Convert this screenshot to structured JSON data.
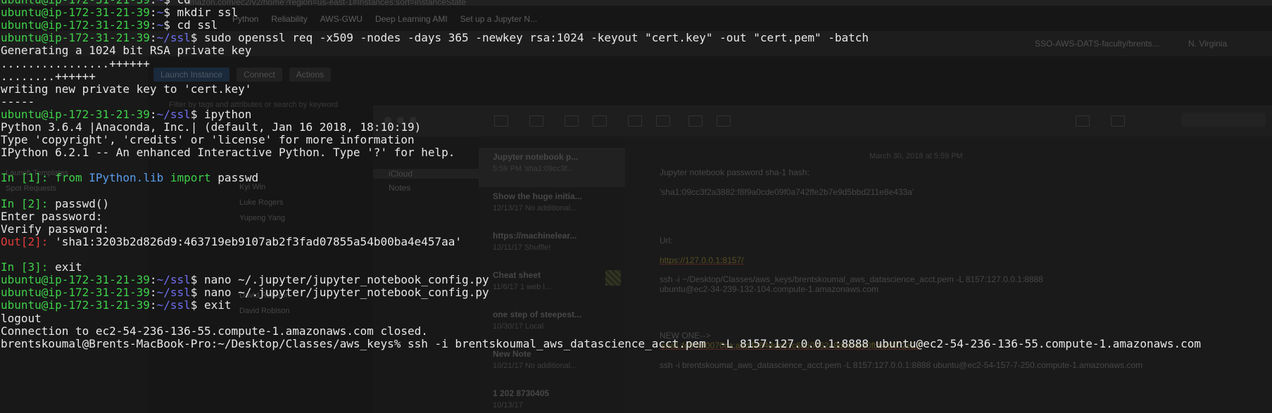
{
  "background": {
    "browser_url": "amazon.com/ec2/v2/home?region=us-east-1#Instances:sort=instanceState",
    "bookmarks": [
      "Python",
      "Reliability",
      "AWS-GWU",
      "Deep Learning AMI",
      "Set up a Jupyter N..."
    ],
    "aws_account": "SSO-AWS-DATS-faculty/brents...",
    "aws_region": "N. Virginia",
    "ec2_buttons": [
      "Launch Instance",
      "Connect",
      "Actions"
    ],
    "ec2_search_placeholder": "Filter by tags and attributes or search by keyword",
    "left_nav_items": [
      "Launch Templates",
      "Spot Requests"
    ],
    "names_column": [
      "Kyi Win",
      "Luke Rogers",
      "Yupeng Yang",
      "David Robison",
      "David Robison"
    ],
    "notes": {
      "folders": [
        "iCloud",
        "Notes"
      ],
      "list": [
        {
          "title": "Jupyter notebook p...",
          "meta": "5:59 PM  'sha1:09cc3f..."
        },
        {
          "title": "Show the huge initia...",
          "meta": "12/13/17  No additional..."
        },
        {
          "title": "https://machinelear...",
          "meta": "12/11/17  Shuffle!"
        },
        {
          "title": "Cheat sheet",
          "meta": "11/6/17  1 web l..."
        },
        {
          "title": "one step of steepest...",
          "meta": "10/30/17  Local"
        },
        {
          "title": "New Note",
          "meta": "10/21/17  No additional..."
        },
        {
          "title": "1 202 8730405",
          "meta": "10/13/17"
        }
      ],
      "body": {
        "date": "March 30, 2018 at 5:59 PM",
        "heading": "Jupyter notebook password sha-1 hash:",
        "hash": "'sha1:09cc3f2a3882:f8f9a0cde09f0a742ffe2b7e9d5bbd211e8e433a'",
        "url_label": "Url:",
        "url": "https://127.0.0.1:8157/",
        "ssh1": "ssh -i ~/Desktop/Classes/aws_keys/brentskoumal_aws_datascience_acct.pem -L 8157:127.0.0.1:8888",
        "ssh1b": "ubuntu@ec2-34-239-132-104.compute-1.amazonaws.com",
        "new_one": "NEW ONE-->",
        "new_hash": "'sha1:fd94df0070ca:a3d4e84dde01c6a5066249d60ab90fbb8d002e29'",
        "ssh2": "ssh -i brentskoumal_aws_datascience_acct.pem -L 8157:127.0.0.1:8888 ubuntu@ec2-54-157-7-250.compute-1.amazonaws.com"
      }
    }
  },
  "terminal": {
    "prompt_user": "ubuntu@ip-172-31-21-39",
    "lines": [
      {
        "type": "prompt",
        "path": "~",
        "cmd": " cd"
      },
      {
        "type": "prompt",
        "path": "~",
        "cmd": " mkdir ssl"
      },
      {
        "type": "prompt",
        "path": "~",
        "cmd": " cd ssl"
      },
      {
        "type": "prompt",
        "path": "~/ssl",
        "cmd": " sudo openssl req -x509 -nodes -days 365 -newkey rsa:1024 -keyout \"cert.key\" -out \"cert.pem\" -batch"
      },
      {
        "type": "out",
        "text": "Generating a 1024 bit RSA private key"
      },
      {
        "type": "out",
        "text": "................++++++"
      },
      {
        "type": "out",
        "text": "........++++++"
      },
      {
        "type": "out",
        "text": "writing new private key to 'cert.key'"
      },
      {
        "type": "out",
        "text": "-----"
      },
      {
        "type": "prompt",
        "path": "~/ssl",
        "cmd": " ipython"
      },
      {
        "type": "out",
        "text": "Python 3.6.4 |Anaconda, Inc.| (default, Jan 16 2018, 18:10:19)"
      },
      {
        "type": "out",
        "text": "Type 'copyright', 'credits' or 'license' for more information"
      },
      {
        "type": "out",
        "text": "IPython 6.2.1 -- An enhanced Interactive Python. Type '?' for help."
      },
      {
        "type": "blank"
      },
      {
        "type": "ipy_import",
        "n": "1",
        "kw_from": "from",
        "module": "IPython.lib",
        "kw_import": "import",
        "name": "passwd"
      },
      {
        "type": "blank"
      },
      {
        "type": "ipy_in",
        "n": "2",
        "code": "passwd()"
      },
      {
        "type": "out",
        "text": "Enter password:"
      },
      {
        "type": "out",
        "text": "Verify password:"
      },
      {
        "type": "ipy_out",
        "n": "2",
        "value": "'sha1:3203b2d826d9:463719eb9107ab2f3fad07855a54b00ba4e457aa'"
      },
      {
        "type": "blank"
      },
      {
        "type": "ipy_in",
        "n": "3",
        "code": "exit"
      },
      {
        "type": "prompt",
        "path": "~/ssl",
        "cmd": " nano ~/.jupyter/jupyter_notebook_config.py"
      },
      {
        "type": "prompt",
        "path": "~/ssl",
        "cmd": " nano ~/.jupyter/jupyter_notebook_config.py"
      },
      {
        "type": "prompt",
        "path": "~/ssl",
        "cmd": " exit"
      },
      {
        "type": "out",
        "text": "logout"
      },
      {
        "type": "out",
        "text": "Connection to ec2-54-236-136-55.compute-1.amazonaws.com closed."
      },
      {
        "type": "out",
        "text": "brentskoumal@Brents-MacBook-Pro:~/Desktop/Classes/aws_keys% ssh -i brentskoumal_aws_datascience_acct.pem  -L 8157:127.0.0.1:8888 ubuntu@ec2-54-236-136-55.compute-1.amazonaws.com"
      }
    ]
  },
  "colors": {
    "prompt_user": "#3fd04a",
    "prompt_path": "#6f6ff0",
    "ipython_in": "#3fd04a",
    "ipython_out": "#e23b3b",
    "ipython_module": "#5a9dec",
    "text": "#e8e8e8"
  }
}
